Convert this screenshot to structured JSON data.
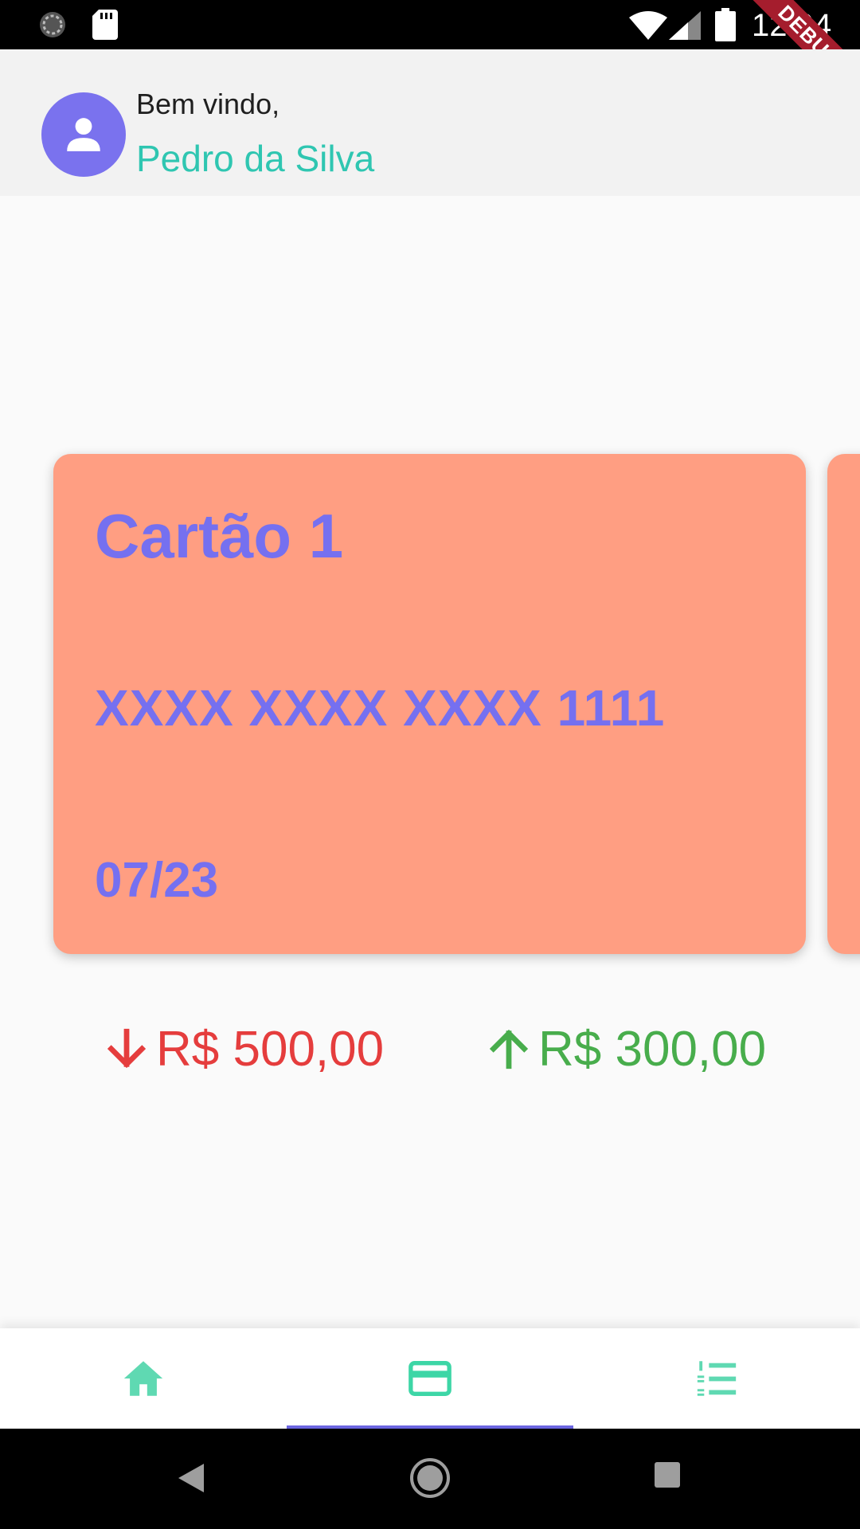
{
  "status_bar": {
    "time": "12:04",
    "icons": [
      "loading-icon",
      "sd-card-icon",
      "wifi-icon",
      "signal-icon",
      "battery-icon"
    ]
  },
  "debug_banner": "DEBUG",
  "header": {
    "greeting": "Bem vindo,",
    "user_name": "Pedro da Silva",
    "avatar_icon": "person-icon"
  },
  "card": {
    "name": "Cartão 1",
    "number": "XXXX XXXX XXXX 1111",
    "expiry": "07/23",
    "background_color": "#ff9e82",
    "text_color": "#7570f0"
  },
  "amounts": {
    "outgoing": {
      "value": "R$ 500,00",
      "icon": "arrow-down-icon",
      "color": "#e53d3d"
    },
    "incoming": {
      "value": "R$ 300,00",
      "icon": "arrow-up-icon",
      "color": "#48ad4c"
    }
  },
  "bottom_nav": {
    "items": [
      {
        "icon": "home-icon",
        "selected": false
      },
      {
        "icon": "credit-card-icon",
        "selected": true
      },
      {
        "icon": "list-numbered-icon",
        "selected": false
      }
    ],
    "accent_color": "#3dd6a6",
    "indicator_color": "#6b66e0"
  },
  "system_nav": [
    "back-icon",
    "home-circle-icon",
    "recents-icon"
  ]
}
